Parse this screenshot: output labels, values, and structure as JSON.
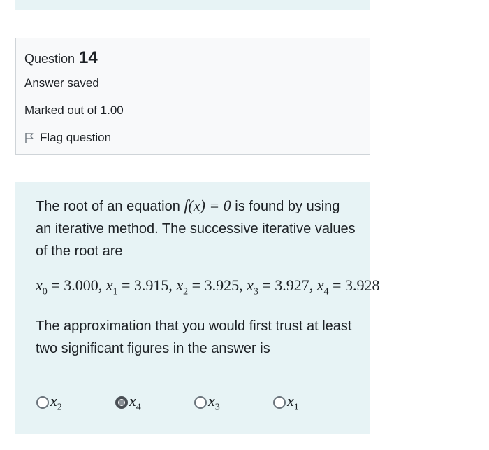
{
  "question": {
    "label": "Question",
    "number": "14",
    "status": "Answer saved",
    "marks": "Marked out of 1.00",
    "flag_label": "Flag question"
  },
  "content": {
    "intro_before": "The root of an equation ",
    "equation": "f(x) = 0",
    "intro_after": " is found by using an iterative method. The successive iterative values of the root are",
    "sequence": [
      {
        "var": "x",
        "sub": "0",
        "value": "3.000"
      },
      {
        "var": "x",
        "sub": "1",
        "value": "3.915"
      },
      {
        "var": "x",
        "sub": "2",
        "value": "3.925"
      },
      {
        "var": "x",
        "sub": "3",
        "value": "3.927"
      },
      {
        "var": "x",
        "sub": "4",
        "value": "3.928"
      }
    ],
    "prompt": "The approximation that you would first trust at least two significant figures in the answer is"
  },
  "options": [
    {
      "var": "x",
      "sub": "2",
      "selected": false
    },
    {
      "var": "x",
      "sub": "4",
      "selected": true
    },
    {
      "var": "x",
      "sub": "3",
      "selected": false
    },
    {
      "var": "x",
      "sub": "1",
      "selected": false
    }
  ],
  "colors": {
    "info_bg": "#f8f9fa",
    "content_bg": "#e7f3f5",
    "border": "#cfd4d8"
  }
}
